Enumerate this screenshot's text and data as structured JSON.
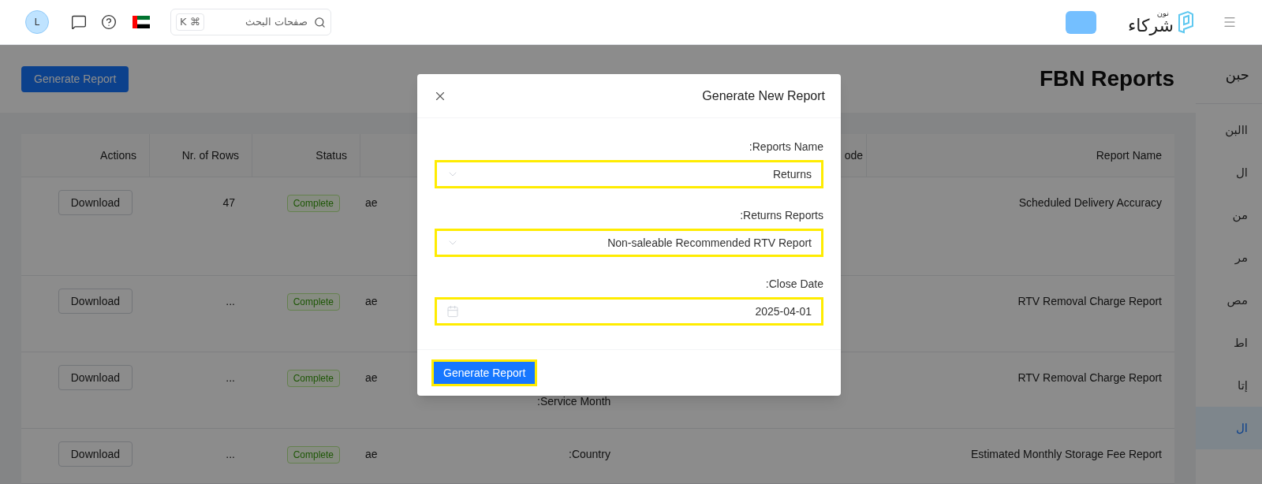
{
  "header": {
    "avatar": "L",
    "search": {
      "placeholder": "صفحات البحث",
      "shortcut": "K ⌘"
    },
    "logo": {
      "small": "نون",
      "main": "شركاء"
    }
  },
  "page": {
    "title": "FBN Reports",
    "generate_button": "Generate Report"
  },
  "sidebar": {
    "title": "حبن",
    "items": [
      {
        "label": "االبن",
        "selected": false
      },
      {
        "label": "ال",
        "selected": false
      },
      {
        "label": "من",
        "selected": false
      },
      {
        "label": "مر",
        "selected": false
      },
      {
        "label": "مص",
        "selected": false
      },
      {
        "label": "اط",
        "selected": false
      },
      {
        "label": "إتا",
        "selected": false
      },
      {
        "label": "ال",
        "selected": true
      }
    ]
  },
  "table": {
    "columns": [
      "Actions",
      "Nr. of Rows",
      "Status",
      "",
      "ode",
      "Report Name"
    ],
    "rows": [
      {
        "action": "Download",
        "rows": "47",
        "status": "Complete",
        "column_4": "ae",
        "details": "",
        "report_name": "Scheduled Delivery Accuracy"
      },
      {
        "action": "Download",
        "rows": "...",
        "status": "Complete",
        "column_4": "ae",
        "details": "",
        "report_name": "RTV Removal Charge Report"
      },
      {
        "action": "Download",
        "rows": "...",
        "status": "Complete",
        "column_4": "ae",
        "details": ":Service Month",
        "report_name": "RTV Removal Charge Report"
      },
      {
        "action": "Download",
        "rows": "...",
        "status": "Complete",
        "column_4": "ae",
        "details": ":Country",
        "report_name": "Estimated Monthly Storage Fee Report"
      }
    ]
  },
  "modal": {
    "title": "Generate New Report",
    "fields": [
      {
        "kind": "select",
        "label": ":Reports Name",
        "value": "Returns",
        "highlighted": true
      },
      {
        "kind": "select",
        "label": ":Returns Reports",
        "value": "Non-saleable Recommended RTV Report",
        "highlighted": true
      },
      {
        "kind": "date",
        "label": ":Close Date",
        "value": "2025-04-01",
        "highlighted": true
      }
    ],
    "submit": {
      "label": "Generate Report",
      "highlighted": true
    }
  }
}
